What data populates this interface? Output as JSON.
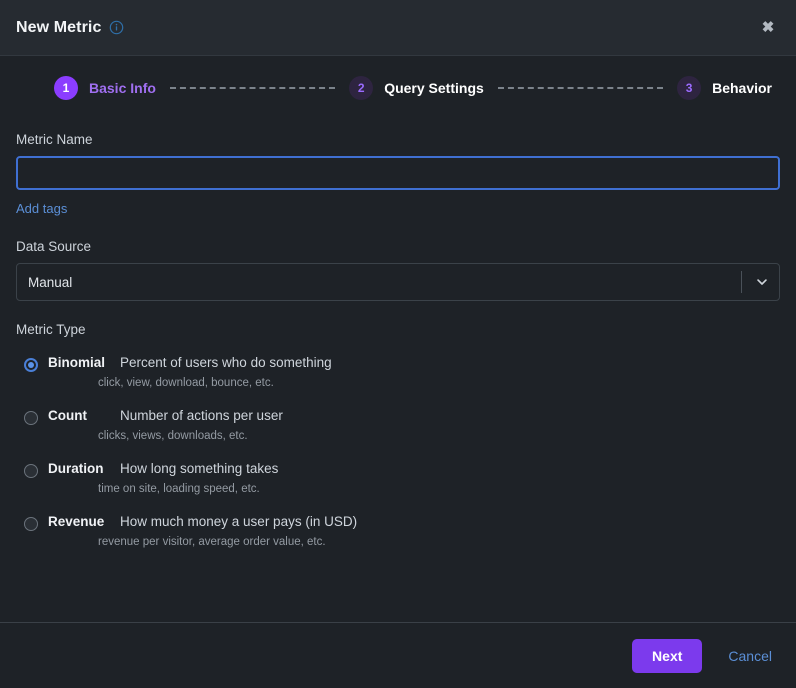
{
  "header": {
    "title": "New Metric",
    "info_icon": "info-circle-icon",
    "close_icon": "close-icon",
    "close_label": "✖"
  },
  "stepper": {
    "steps": [
      {
        "number": "1",
        "label": "Basic Info",
        "state": "active"
      },
      {
        "number": "2",
        "label": "Query Settings",
        "state": "inactive"
      },
      {
        "number": "3",
        "label": "Behavior",
        "state": "inactive"
      }
    ]
  },
  "form": {
    "metric_name": {
      "label": "Metric Name",
      "value": "",
      "placeholder": ""
    },
    "add_tags_link": "Add tags",
    "data_source": {
      "label": "Data Source",
      "value": "Manual",
      "chevron_icon": "chevron-down-icon"
    },
    "metric_type": {
      "label": "Metric Type",
      "options": [
        {
          "name": "Binomial",
          "description": "Percent of users who do something",
          "examples": "click, view, download, bounce, etc.",
          "selected": true
        },
        {
          "name": "Count",
          "description": "Number of actions per user",
          "examples": "clicks, views, downloads, etc.",
          "selected": false
        },
        {
          "name": "Duration",
          "description": "How long something takes",
          "examples": "time on site, loading speed, etc.",
          "selected": false
        },
        {
          "name": "Revenue",
          "description": "How much money a user pays (in USD)",
          "examples": "revenue per visitor, average order value, etc.",
          "selected": false
        }
      ]
    }
  },
  "footer": {
    "next_label": "Next",
    "cancel_label": "Cancel"
  },
  "colors": {
    "accent_purple": "#7c3aed",
    "step_active": "#8b3dff",
    "link_blue": "#5b8fd6",
    "focus_blue": "#3f6fd1",
    "background": "#1e2227",
    "header_background": "#262b31"
  }
}
